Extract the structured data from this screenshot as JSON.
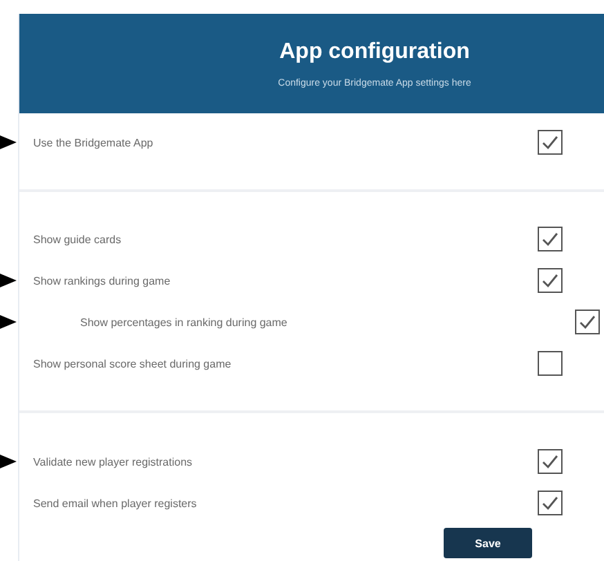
{
  "header": {
    "title": "App configuration",
    "subtitle": "Configure your Bridgemate App settings here"
  },
  "sections": [
    {
      "settings": [
        {
          "label": "Use the Bridgemate App",
          "checked": true,
          "pointed": true
        }
      ]
    },
    {
      "settings": [
        {
          "label": "Show guide cards",
          "checked": true,
          "pointed": false
        },
        {
          "label": "Show rankings during game",
          "checked": true,
          "pointed": true,
          "children": [
            {
              "label": "Show percentages in ranking during game",
              "checked": true,
              "pointed": true
            }
          ]
        },
        {
          "label": "Show personal score sheet during game",
          "checked": false,
          "pointed": false
        }
      ]
    },
    {
      "settings": [
        {
          "label": "Validate new player registrations",
          "checked": true,
          "pointed": true
        },
        {
          "label": "Send email when player registers",
          "checked": true,
          "pointed": false
        }
      ]
    }
  ],
  "save_button": "Save"
}
